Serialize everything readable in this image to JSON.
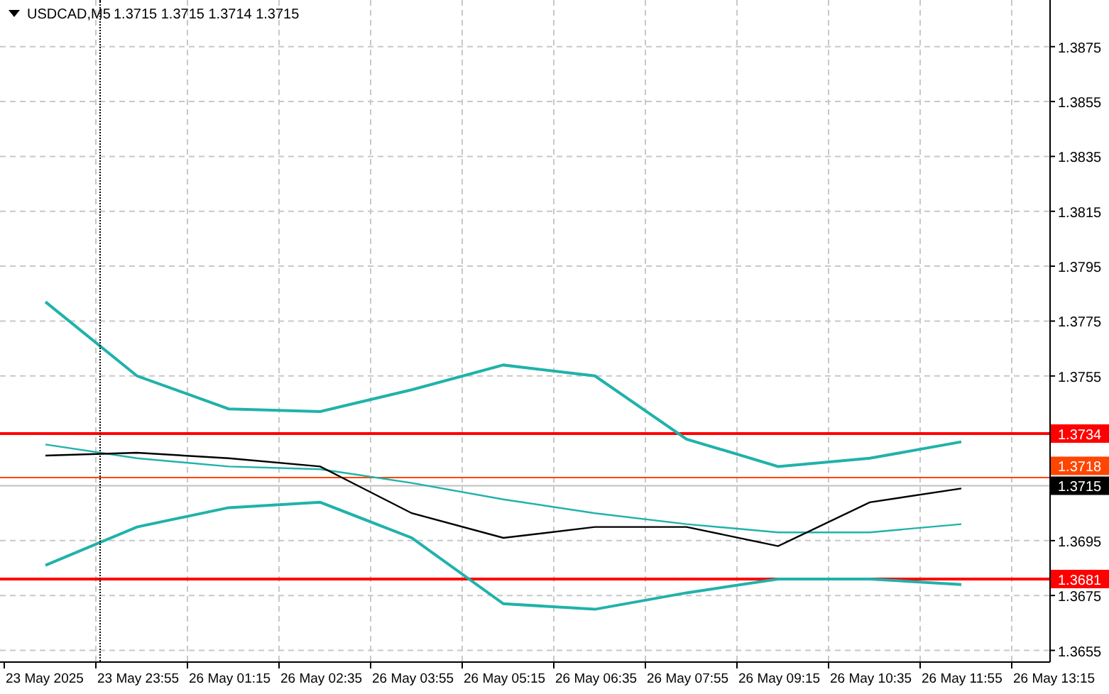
{
  "header": {
    "symbol": "USDCAD,M5",
    "quotes": [
      "1.3715",
      "1.3715",
      "1.3714",
      "1.3715"
    ]
  },
  "chart_data": {
    "type": "line",
    "grid": true,
    "categories": [
      "23 May 2025",
      "23 May 23:55",
      "26 May 01:15",
      "26 May 02:35",
      "26 May 03:55",
      "26 May 05:15",
      "26 May 06:35",
      "26 May 07:55",
      "26 May 09:15",
      "26 May 10:35",
      "26 May 11:55",
      "26 May 13:15"
    ],
    "series": [
      {
        "color": "#20b2aa",
        "values": [
          1.3782,
          1.3755,
          1.3743,
          1.3742,
          1.375,
          1.3759,
          1.3755,
          1.3732,
          1.3722,
          1.3725,
          1.3731,
          null
        ]
      },
      {
        "color": "#20b2aa",
        "values": [
          1.373,
          1.3725,
          1.3722,
          1.3721,
          1.3716,
          1.371,
          1.3705,
          1.3701,
          1.3698,
          1.3698,
          1.3701,
          null
        ]
      },
      {
        "color": "#20b2aa",
        "values": [
          1.3686,
          1.37,
          1.3707,
          1.3709,
          1.3696,
          1.3672,
          1.367,
          1.3676,
          1.3681,
          1.3681,
          1.3679,
          null
        ]
      },
      {
        "color": "#000000",
        "values": [
          1.3726,
          1.3727,
          1.3725,
          1.3722,
          1.3705,
          1.3696,
          1.37,
          1.37,
          1.3693,
          1.3709,
          1.3714,
          null
        ]
      }
    ],
    "ylim": [
      1.3651,
      1.3892
    ],
    "yticks": [
      1.3875,
      1.3855,
      1.3835,
      1.3815,
      1.3795,
      1.3775,
      1.3755,
      1.3695,
      1.3675,
      1.3655
    ],
    "ref_lines": [
      {
        "axis": "y",
        "value": 1.3734,
        "label": "1.3734",
        "color": "#ff0000"
      },
      {
        "axis": "y",
        "value": 1.3718,
        "label": "1.3718",
        "color": "#ff4500"
      },
      {
        "axis": "y",
        "value": 1.3715,
        "label": "1.3715",
        "color": "#c0c0c0"
      },
      {
        "axis": "y",
        "value": 1.3681,
        "label": "1.3681",
        "color": "#ff0000"
      }
    ]
  }
}
